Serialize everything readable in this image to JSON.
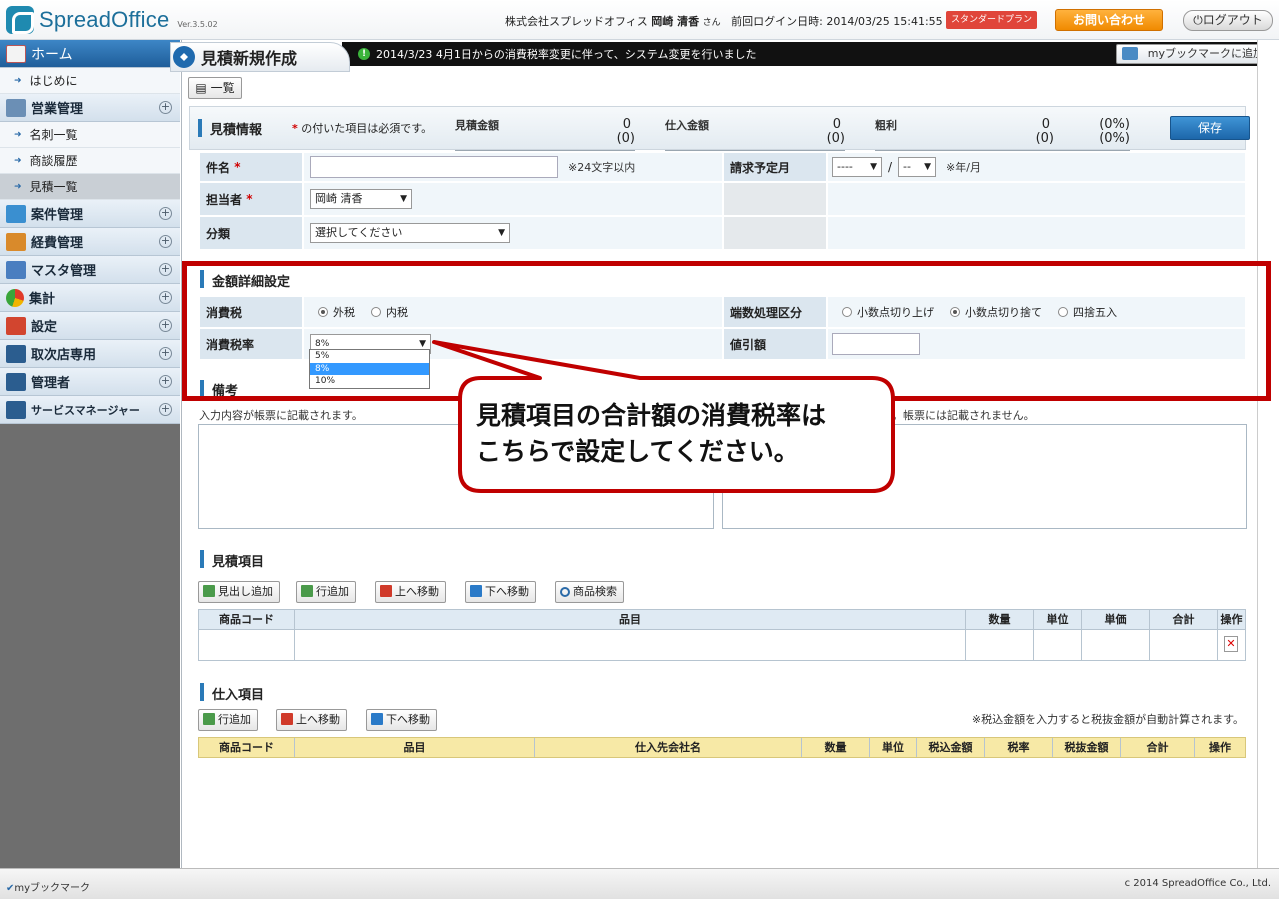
{
  "header": {
    "logo_text": "SpreadOffice",
    "version": "Ver.3.5.02",
    "company": "株式会社スプレッドオフィス",
    "user_name": "岡崎 清香",
    "user_suffix": "さん",
    "last_login_label": "前回ログイン日時:",
    "last_login": "2014/03/25 15:41:55",
    "plan": "スタンダードプラン",
    "contact": "お問い合わせ",
    "logout": "ログアウト"
  },
  "sidebar": {
    "home": "ホーム",
    "groups": [
      {
        "label": "はじめに",
        "type": "item"
      },
      {
        "label": "営業管理",
        "type": "group"
      },
      {
        "label": "名刺一覧",
        "type": "item"
      },
      {
        "label": "商談履歴",
        "type": "item"
      },
      {
        "label": "見積一覧",
        "type": "item",
        "active": true
      },
      {
        "label": "案件管理",
        "type": "group"
      },
      {
        "label": "経費管理",
        "type": "group"
      },
      {
        "label": "マスタ管理",
        "type": "group"
      },
      {
        "label": "集計",
        "type": "group"
      },
      {
        "label": "設定",
        "type": "group"
      },
      {
        "label": "取次店専用",
        "type": "group"
      },
      {
        "label": "管理者",
        "type": "group"
      },
      {
        "label": "サービスマネージャー",
        "type": "group"
      }
    ]
  },
  "main": {
    "page_title": "見積新規作成",
    "news": "2014/3/23 4月1日からの消費税率変更に伴って、システム変更を行いました",
    "bookmark_add": "myブックマークに追加",
    "list_button": "一覧",
    "info": {
      "title": "見積情報",
      "required_note": "の付いた項目は必須です。",
      "estimate_amount_label": "見積金額",
      "estimate_amount": "0",
      "estimate_amount_sub": "(0)",
      "purchase_amount_label": "仕入金額",
      "purchase_amount": "0",
      "purchase_amount_sub": "(0)",
      "gross_label": "粗利",
      "gross": "0",
      "gross_sub": "(0)",
      "gross_pct": "(0%)",
      "gross_pct_sub": "(0%)",
      "save": "保存"
    },
    "fields": {
      "name_label": "件名",
      "name_note": "※24文字以内",
      "billing_month_label": "請求予定月",
      "year_value": "----",
      "month_value": "--",
      "slash": "/",
      "ym_note": "※年/月",
      "person_label": "担当者",
      "person_value": "岡崎 清香",
      "category_label": "分類",
      "category_value": "選択してください"
    },
    "amount_detail": {
      "title": "金額詳細設定",
      "tax_label": "消費税",
      "tax_options": [
        "外税",
        "内税"
      ],
      "rounding_label": "端数処理区分",
      "rounding_options": [
        "小数点切り上げ",
        "小数点切り捨て",
        "四捨五入"
      ],
      "rate_label": "消費税率",
      "rate_value": "8%",
      "rate_options": [
        "5%",
        "8%",
        "10%"
      ],
      "discount_label": "値引額"
    },
    "remarks": {
      "title": "備考",
      "left_note": "入力内容が帳票に記載されます。",
      "right_note": "。帳票には記載されません。"
    },
    "callout": {
      "line1": "見積項目の合計額の消費税率は",
      "line2": "こちらで設定してください。"
    },
    "estimate_items": {
      "title": "見積項目",
      "buttons": [
        "見出し追加",
        "行追加",
        "上へ移動",
        "下へ移動",
        "商品検索"
      ],
      "columns": [
        "商品コード",
        "品目",
        "数量",
        "単位",
        "単価",
        "合計",
        "操作"
      ]
    },
    "purchase_items": {
      "title": "仕入項目",
      "buttons": [
        "行追加",
        "上へ移動",
        "下へ移動"
      ],
      "note": "※税込金額を入力すると税抜金額が自動計算されます。",
      "columns": [
        "商品コード",
        "品目",
        "仕入先会社名",
        "数量",
        "単位",
        "税込金額",
        "税率",
        "税抜金額",
        "合計",
        "操作"
      ]
    }
  },
  "footer": {
    "bookmark": "myブックマーク",
    "copyright": "c 2014 SpreadOffice Co., Ltd."
  },
  "colors": {
    "accent": "#1d67aa",
    "highlight": "#c00000",
    "purchase_header": "#f7e9a6",
    "estimate_header": "#dfeaf3"
  }
}
